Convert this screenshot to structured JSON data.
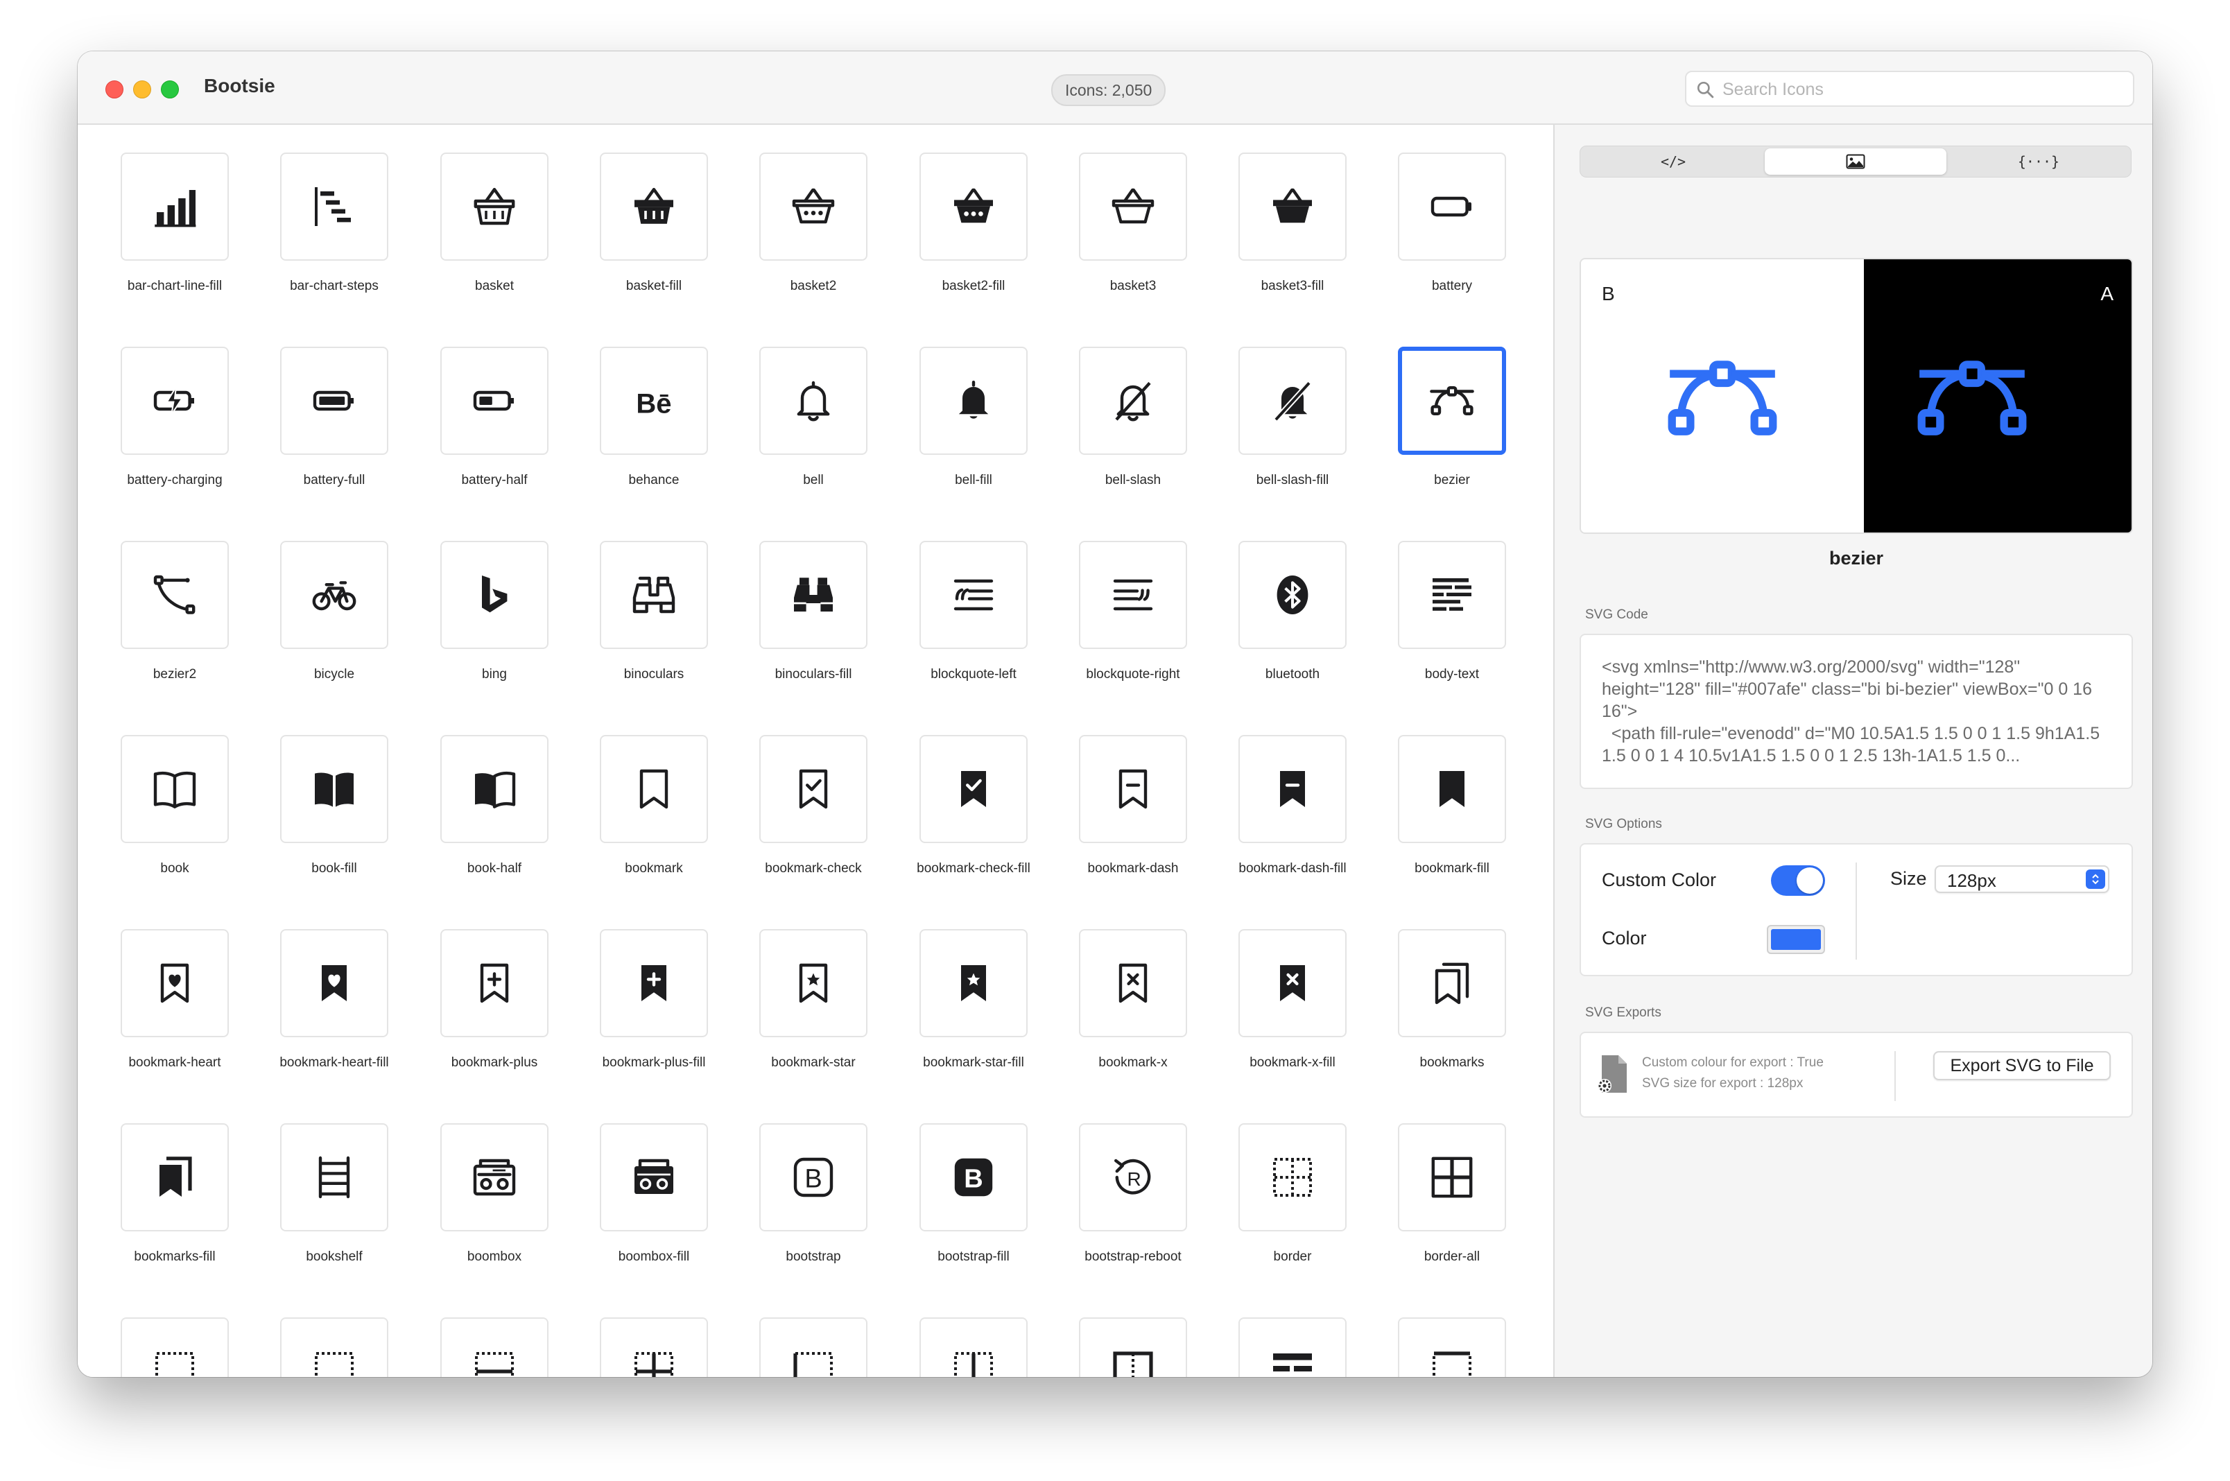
{
  "window": {
    "title": "Bootsie",
    "icon_count": "Icons: 2,050",
    "search_placeholder": "Search Icons"
  },
  "icons": [
    {
      "label": "bar-chart-line-fill",
      "icon": "bar-chart-line-fill-icon"
    },
    {
      "label": "bar-chart-steps",
      "icon": "bar-chart-steps-icon"
    },
    {
      "label": "basket",
      "icon": "basket-icon"
    },
    {
      "label": "basket-fill",
      "icon": "basket-fill-icon"
    },
    {
      "label": "basket2",
      "icon": "basket2-icon"
    },
    {
      "label": "basket2-fill",
      "icon": "basket2-fill-icon"
    },
    {
      "label": "basket3",
      "icon": "basket3-icon"
    },
    {
      "label": "basket3-fill",
      "icon": "basket3-fill-icon"
    },
    {
      "label": "battery",
      "icon": "battery-icon"
    },
    {
      "label": "battery-charging",
      "icon": "battery-charging-icon"
    },
    {
      "label": "battery-full",
      "icon": "battery-full-icon"
    },
    {
      "label": "battery-half",
      "icon": "battery-half-icon"
    },
    {
      "label": "behance",
      "icon": "behance-icon"
    },
    {
      "label": "bell",
      "icon": "bell-icon"
    },
    {
      "label": "bell-fill",
      "icon": "bell-fill-icon"
    },
    {
      "label": "bell-slash",
      "icon": "bell-slash-icon"
    },
    {
      "label": "bell-slash-fill",
      "icon": "bell-slash-fill-icon"
    },
    {
      "label": "bezier",
      "icon": "bezier-icon",
      "selected": true
    },
    {
      "label": "bezier2",
      "icon": "bezier2-icon"
    },
    {
      "label": "bicycle",
      "icon": "bicycle-icon"
    },
    {
      "label": "bing",
      "icon": "bing-icon"
    },
    {
      "label": "binoculars",
      "icon": "binoculars-icon"
    },
    {
      "label": "binoculars-fill",
      "icon": "binoculars-fill-icon"
    },
    {
      "label": "blockquote-left",
      "icon": "blockquote-left-icon"
    },
    {
      "label": "blockquote-right",
      "icon": "blockquote-right-icon"
    },
    {
      "label": "bluetooth",
      "icon": "bluetooth-icon"
    },
    {
      "label": "body-text",
      "icon": "body-text-icon"
    },
    {
      "label": "book",
      "icon": "book-icon"
    },
    {
      "label": "book-fill",
      "icon": "book-fill-icon"
    },
    {
      "label": "book-half",
      "icon": "book-half-icon"
    },
    {
      "label": "bookmark",
      "icon": "bookmark-icon"
    },
    {
      "label": "bookmark-check",
      "icon": "bookmark-check-icon"
    },
    {
      "label": "bookmark-check-fill",
      "icon": "bookmark-check-fill-icon"
    },
    {
      "label": "bookmark-dash",
      "icon": "bookmark-dash-icon"
    },
    {
      "label": "bookmark-dash-fill",
      "icon": "bookmark-dash-fill-icon"
    },
    {
      "label": "bookmark-fill",
      "icon": "bookmark-fill-icon"
    },
    {
      "label": "bookmark-heart",
      "icon": "bookmark-heart-icon"
    },
    {
      "label": "bookmark-heart-fill",
      "icon": "bookmark-heart-fill-icon"
    },
    {
      "label": "bookmark-plus",
      "icon": "bookmark-plus-icon"
    },
    {
      "label": "bookmark-plus-fill",
      "icon": "bookmark-plus-fill-icon"
    },
    {
      "label": "bookmark-star",
      "icon": "bookmark-star-icon"
    },
    {
      "label": "bookmark-star-fill",
      "icon": "bookmark-star-fill-icon"
    },
    {
      "label": "bookmark-x",
      "icon": "bookmark-x-icon"
    },
    {
      "label": "bookmark-x-fill",
      "icon": "bookmark-x-fill-icon"
    },
    {
      "label": "bookmarks",
      "icon": "bookmarks-icon"
    },
    {
      "label": "bookmarks-fill",
      "icon": "bookmarks-fill-icon"
    },
    {
      "label": "bookshelf",
      "icon": "bookshelf-icon"
    },
    {
      "label": "boombox",
      "icon": "boombox-icon"
    },
    {
      "label": "boombox-fill",
      "icon": "boombox-fill-icon"
    },
    {
      "label": "bootstrap",
      "icon": "bootstrap-icon"
    },
    {
      "label": "bootstrap-fill",
      "icon": "bootstrap-fill-icon"
    },
    {
      "label": "bootstrap-reboot",
      "icon": "bootstrap-reboot-icon"
    },
    {
      "label": "border",
      "icon": "border-icon"
    },
    {
      "label": "border-all",
      "icon": "border-all-icon"
    },
    {
      "label": "",
      "icon": "border-bottom-icon"
    },
    {
      "label": "",
      "icon": "border-bottom-icon"
    },
    {
      "label": "",
      "icon": "border-center-icon"
    },
    {
      "label": "",
      "icon": "border-inner-icon"
    },
    {
      "label": "",
      "icon": "border-left-icon"
    },
    {
      "label": "",
      "icon": "border-middle-icon"
    },
    {
      "label": "",
      "icon": "border-outer-icon"
    },
    {
      "label": "",
      "icon": "border-style-icon"
    },
    {
      "label": "",
      "icon": "border-top-icon"
    }
  ],
  "panel": {
    "tabs": [
      {
        "label": "</>",
        "icon": "code-icon"
      },
      {
        "label": "",
        "icon": "image-icon",
        "active": true
      },
      {
        "label": "{···}",
        "icon": "braces-icon"
      }
    ],
    "preview": {
      "light_label": "B",
      "dark_label": "A",
      "name": "bezier"
    },
    "svg_code": {
      "section": "SVG Code",
      "text": "<svg xmlns=\"http://www.w3.org/2000/svg\" width=\"128\" height=\"128\" fill=\"#007afe\" class=\"bi bi-bezier\" viewBox=\"0 0 16 16\">\n  <path fill-rule=\"evenodd\" d=\"M0 10.5A1.5 1.5 0 0 1 1.5 9h1A1.5 1.5 0 0 1 4 10.5v1A1.5 1.5 0 0 1 2.5 13h-1A1.5 1.5 0..."
    },
    "svg_options": {
      "section": "SVG Options",
      "custom_color_label": "Custom Color",
      "custom_color_on": true,
      "color_label": "Color",
      "color_value": "#2f6ff6",
      "size_label": "Size",
      "size_value": "128px"
    },
    "svg_exports": {
      "section": "SVG Exports",
      "info_line1": "Custom colour for export : True",
      "info_line2": "SVG size for export : 128px",
      "export_button": "Export SVG to File"
    }
  },
  "colors": {
    "accent": "#2f6ff6",
    "icon_ink": "#1d1d1f"
  }
}
